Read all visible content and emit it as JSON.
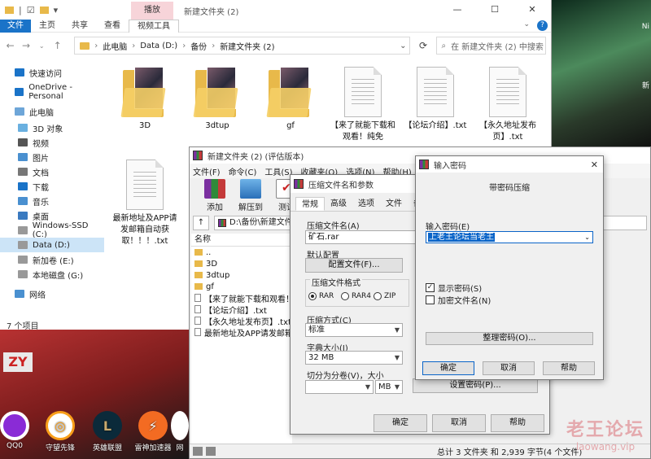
{
  "explorer": {
    "window_title": "新建文件夹 (2)",
    "context_tab": "播放",
    "ribbon_tabs": [
      "文件",
      "主页",
      "共享",
      "查看",
      "视频工具"
    ],
    "address": [
      "此电脑",
      "Data (D:)",
      "备份",
      "新建文件夹 (2)"
    ],
    "search_placeholder": "在 新建文件夹 (2) 中搜索",
    "sidebar": [
      {
        "label": "快速访问",
        "icon": "star-icon",
        "indent": 0
      },
      {
        "label": "OneDrive - Personal",
        "icon": "cloud-icon",
        "indent": 0
      },
      {
        "label": "此电脑",
        "icon": "computer-icon",
        "indent": 0
      },
      {
        "label": "3D 对象",
        "icon": "cube-icon",
        "indent": 1
      },
      {
        "label": "视频",
        "icon": "video-icon",
        "indent": 1
      },
      {
        "label": "图片",
        "icon": "picture-icon",
        "indent": 1
      },
      {
        "label": "文档",
        "icon": "document-icon",
        "indent": 1
      },
      {
        "label": "下载",
        "icon": "download-icon",
        "indent": 1
      },
      {
        "label": "音乐",
        "icon": "music-icon",
        "indent": 1
      },
      {
        "label": "桌面",
        "icon": "desktop-icon",
        "indent": 1
      },
      {
        "label": "Windows-SSD (C:)",
        "icon": "drive-icon",
        "indent": 1
      },
      {
        "label": "Data (D:)",
        "icon": "drive-icon",
        "indent": 1,
        "selected": true
      },
      {
        "label": "新加卷 (E:)",
        "icon": "drive-icon",
        "indent": 1
      },
      {
        "label": "本地磁盘 (G:)",
        "icon": "drive-icon",
        "indent": 1
      },
      {
        "label": "网络",
        "icon": "network-icon",
        "indent": 0
      }
    ],
    "items": [
      {
        "label": "3D",
        "type": "folder"
      },
      {
        "label": "3dtup",
        "type": "folder"
      },
      {
        "label": "gf",
        "type": "folder"
      },
      {
        "label": "【来了就能下载和观看！纯免",
        "type": "doc"
      },
      {
        "label": "【论坛介绍】.txt",
        "type": "doc"
      },
      {
        "label": "【永久地址发布页】.txt",
        "type": "doc"
      },
      {
        "label": "最新地址及APP请发邮箱自动获取！！！.txt",
        "type": "doc"
      }
    ],
    "status": "7 个项目"
  },
  "winrar": {
    "title": "新建文件夹 (2) (评估版本)",
    "menu": [
      "文件(F)",
      "命令(C)",
      "工具(S)",
      "收藏夹(O)",
      "选项(N)",
      "帮助(H)"
    ],
    "toolbar": [
      "添加",
      "解压到",
      "测试"
    ],
    "path": "D:\\备份\\新建文件夹",
    "list_header": "名称",
    "list": [
      {
        "label": "..",
        "type": "folder"
      },
      {
        "label": "3D",
        "type": "folder"
      },
      {
        "label": "3dtup",
        "type": "folder"
      },
      {
        "label": "gf",
        "type": "folder"
      },
      {
        "label": "【来了就能下载和观看！...",
        "type": "doc"
      },
      {
        "label": "【论坛介绍】.txt",
        "type": "doc"
      },
      {
        "label": "【永久地址发布页】.txt",
        "type": "doc"
      },
      {
        "label": "最新地址及APP请发邮箱...",
        "type": "doc"
      }
    ],
    "status": "总计 3 文件夹 和 2,939 字节(4 个文件)"
  },
  "archive_dialog": {
    "title": "压缩文件名和参数",
    "tabs": [
      "常规",
      "高级",
      "选项",
      "文件",
      "备份"
    ],
    "archive_name_label": "压缩文件名(A)",
    "archive_name": "矿石.rar",
    "default_config_label": "默认配置",
    "config_button": "配置文件(F)...",
    "format_label": "压缩文件格式",
    "formats": [
      "RAR",
      "RAR4",
      "ZIP"
    ],
    "format_selected": "RAR",
    "method_label": "压缩方式(C)",
    "method": "标准",
    "dict_label": "字典大小(I)",
    "dict": "32 MB",
    "split_label": "切分为分卷(V)，大小",
    "split_unit": "MB",
    "set_password_button": "设置密码(P)...",
    "ok": "确定",
    "cancel": "取消",
    "help": "帮助"
  },
  "password_dialog": {
    "title": "输入密码",
    "heading": "带密码压缩",
    "input_label": "输入密码(E)",
    "password_value": "上老王论坛当老王",
    "show_password_label": "显示密码(S)",
    "show_password_checked": true,
    "encrypt_names_label": "加密文件名(N)",
    "encrypt_names_checked": false,
    "manage_button": "整理密码(O)...",
    "ok": "确定",
    "cancel": "取消",
    "help": "帮助"
  },
  "desktop": {
    "icons": [
      "QQ0",
      "守望先锋",
      "英雄联盟",
      "雷神加速器",
      "网"
    ],
    "left_label": "ZY",
    "watermark_big": "老王论坛",
    "watermark_small": "laowang.vip",
    "right_labels": [
      "Ni",
      "新"
    ]
  }
}
